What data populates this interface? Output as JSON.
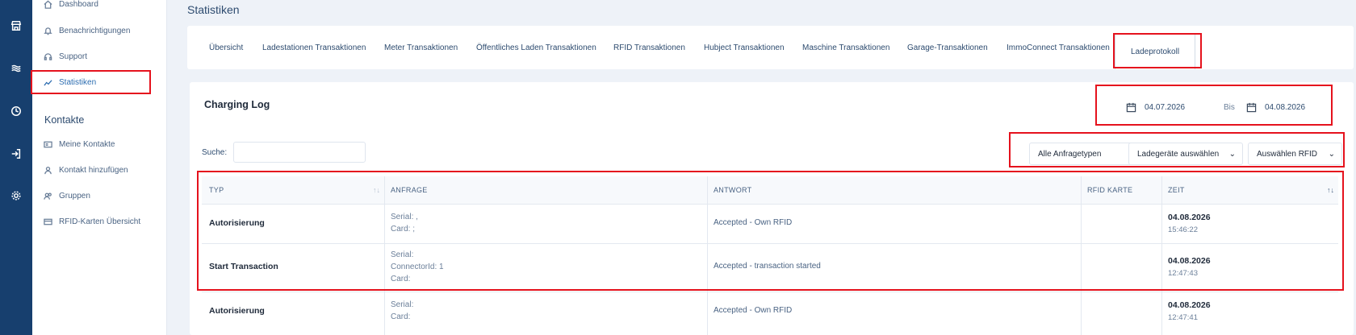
{
  "rail": {
    "icons": [
      "store-icon",
      "waves-icon",
      "clock-icon",
      "sign-in-icon",
      "gear-icon"
    ]
  },
  "sidebar": {
    "items_top": [
      {
        "label": "Dashboard",
        "icon": "home-icon"
      },
      {
        "label": "Benachrichtigungen",
        "icon": "bell-icon"
      },
      {
        "label": "Support",
        "icon": "headset-icon"
      },
      {
        "label": "Statistiken",
        "icon": "chart-line-icon",
        "active": true
      }
    ],
    "section_heading": "Kontakte",
    "items_contacts": [
      {
        "label": "Meine Kontakte",
        "icon": "address-card-icon"
      },
      {
        "label": "Kontakt hinzufügen",
        "icon": "user-plus-icon"
      },
      {
        "label": "Gruppen",
        "icon": "users-icon"
      },
      {
        "label": "RFID-Karten Übersicht",
        "icon": "credit-card-icon"
      }
    ]
  },
  "page": {
    "title": "Statistiken"
  },
  "tabs": [
    "Übersicht",
    "Ladestationen Transaktionen",
    "Meter Transaktionen",
    "Öffentliches Laden Transaktionen",
    "RFID Transaktionen",
    "Hubject Transaktionen",
    "Maschine Transaktionen",
    "Garage-Transaktionen",
    "ImmoConnect Transaktionen",
    "Ladeprotokoll"
  ],
  "active_tab": "Ladeprotokoll",
  "card": {
    "title": "Charging Log",
    "date_from": "04.07.2026",
    "date_sep": "Bis",
    "date_to": "04.08.2026",
    "search_label": "Suche:",
    "search_value": "",
    "filters": [
      "Alle Anfragetypen",
      "Ladegeräte auswählen",
      "Auswählen RFID"
    ]
  },
  "table": {
    "columns": [
      "TYP",
      "ANFRAGE",
      "ANTWORT",
      "RFID KARTE",
      "ZEIT"
    ],
    "rows": [
      {
        "typ": "Autorisierung",
        "anfrage": [
          "Serial:  ,",
          "Card: ;"
        ],
        "antwort": "Accepted - Own RFID",
        "rfid": "",
        "date": "04.08.2026",
        "time": "15:46:22"
      },
      {
        "typ": "Start Transaction",
        "anfrage": [
          "Serial:",
          "ConnectorId: 1",
          "Card:"
        ],
        "antwort": "Accepted - transaction started",
        "rfid": "",
        "date": "04.08.2026",
        "time": "12:47:43"
      },
      {
        "typ": "Autorisierung",
        "anfrage": [
          "Serial:",
          "Card:"
        ],
        "antwort": "Accepted - Own RFID",
        "rfid": "",
        "date": "04.08.2026",
        "time": "12:47:41"
      }
    ]
  },
  "colors": {
    "rail": "#173f6e",
    "accent": "#2b6cb0",
    "highlight": "#e5121d"
  }
}
